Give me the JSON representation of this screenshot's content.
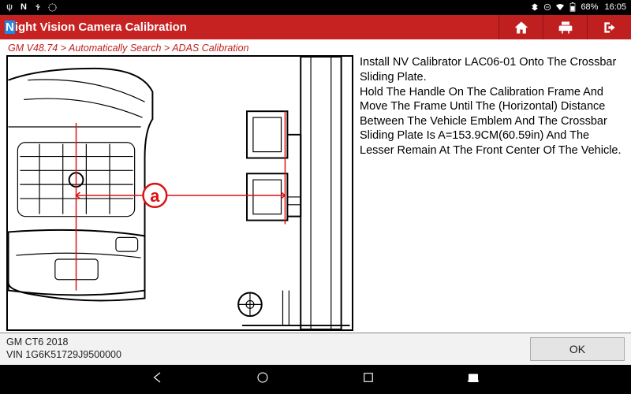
{
  "statusbar": {
    "battery": "68%",
    "time": "16:05"
  },
  "header": {
    "title_prefix": "N",
    "title_rest": "ight Vision Camera Calibration"
  },
  "breadcrumb": "GM V48.74 > Automatically Search > ADAS Calibration",
  "instructions": "Install NV Calibrator LAC06-01 Onto The Crossbar Sliding Plate.\nHold The Handle On The Calibration Frame And Move The Frame Until The (Horizontal) Distance Between The Vehicle Emblem And The Crossbar Sliding Plate Is A=153.9CM(60.59in) And The Lesser Remain At The Front Center Of The Vehicle.",
  "measurement_symbol": "a",
  "vehicle": {
    "model": "GM CT6 2018",
    "vin": "VIN 1G6K51729J9500000"
  },
  "buttons": {
    "ok": "OK"
  }
}
